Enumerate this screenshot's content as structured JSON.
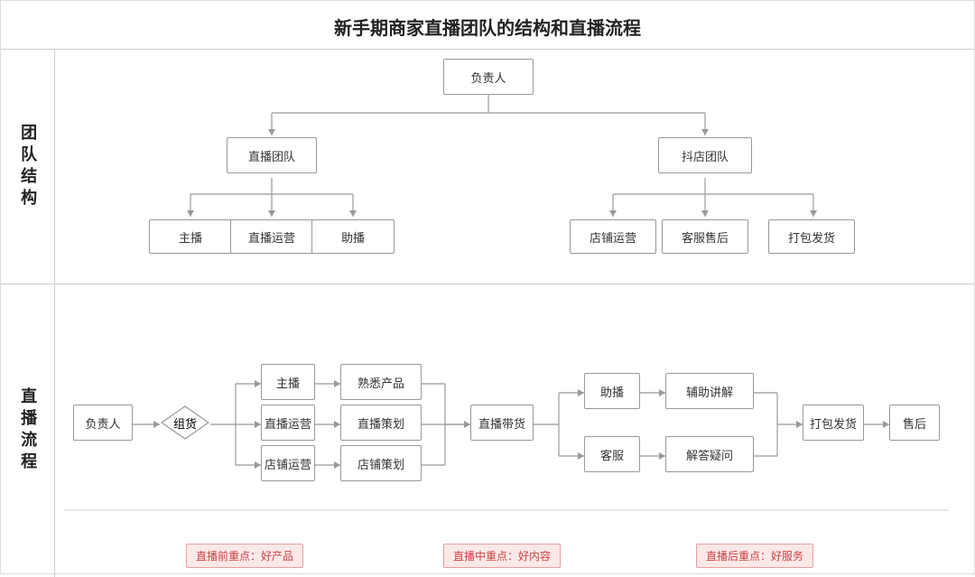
{
  "title": "新手期商家直播团队的结构和直播流程",
  "section1_label": "团队\n结构",
  "section2_label": "直播\n流程",
  "team_structure": {
    "root": "负责人",
    "left_branch": {
      "name": "直播团队",
      "children": [
        "主播",
        "直播运营",
        "助播"
      ]
    },
    "right_branch": {
      "name": "抖店团队",
      "children": [
        "店铺运营",
        "客服售后",
        "打包发货"
      ]
    }
  },
  "live_flow": {
    "nodes": [
      {
        "id": "fzr",
        "label": "负责人"
      },
      {
        "id": "zu",
        "label": "组货"
      },
      {
        "id": "zb",
        "label": "主播"
      },
      {
        "id": "zbyy",
        "label": "直播运营"
      },
      {
        "id": "dpyy",
        "label": "店铺运营"
      },
      {
        "id": "scp",
        "label": "熟悉产品"
      },
      {
        "id": "zbcl",
        "label": "直播策划"
      },
      {
        "id": "dpcl",
        "label": "店铺策划"
      },
      {
        "id": "zbdh",
        "label": "直播带货"
      },
      {
        "id": "zb2",
        "label": "助播"
      },
      {
        "id": "fzjj",
        "label": "辅助讲解"
      },
      {
        "id": "ks",
        "label": "客服"
      },
      {
        "id": "jdyw",
        "label": "解答疑问"
      },
      {
        "id": "dbfh",
        "label": "打包发货"
      },
      {
        "id": "sh",
        "label": "售后"
      }
    ],
    "highlights": [
      {
        "label": "直播前重点：好产品"
      },
      {
        "label": "直播中重点：好内容"
      },
      {
        "label": "直播后重点：好服务"
      }
    ]
  }
}
